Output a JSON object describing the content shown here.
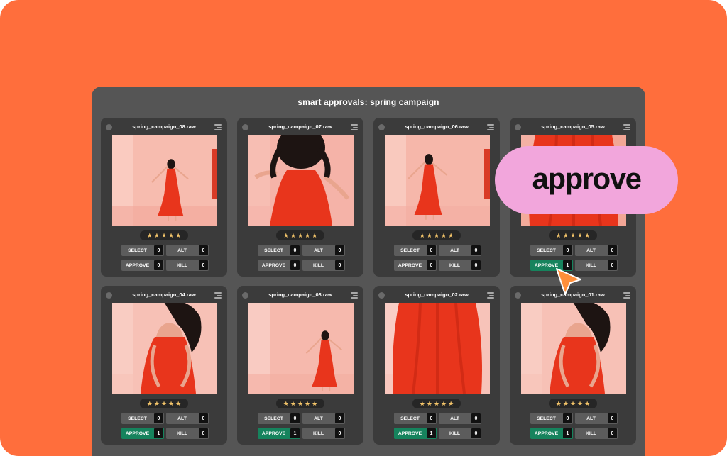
{
  "app": {
    "title": "smart approvals: spring campaign"
  },
  "labels": {
    "select": "SELECT",
    "alt": "ALT",
    "approve": "APPROVE",
    "kill": "KILL"
  },
  "cards": [
    {
      "file": "spring_campaign_08.raw",
      "rating": 5,
      "counts": {
        "select": "0",
        "alt": "0",
        "approve": "0",
        "kill": "0"
      },
      "approved": false
    },
    {
      "file": "spring_campaign_07.raw",
      "rating": 5,
      "counts": {
        "select": "0",
        "alt": "0",
        "approve": "0",
        "kill": "0"
      },
      "approved": false
    },
    {
      "file": "spring_campaign_06.raw",
      "rating": 5,
      "counts": {
        "select": "0",
        "alt": "0",
        "approve": "0",
        "kill": "0"
      },
      "approved": false
    },
    {
      "file": "spring_campaign_05.raw",
      "rating": 5,
      "counts": {
        "select": "0",
        "alt": "0",
        "approve": "1",
        "kill": "0"
      },
      "approved": true
    },
    {
      "file": "spring_campaign_04.raw",
      "rating": 5,
      "counts": {
        "select": "0",
        "alt": "0",
        "approve": "1",
        "kill": "0"
      },
      "approved": true
    },
    {
      "file": "spring_campaign_03.raw",
      "rating": 5,
      "counts": {
        "select": "0",
        "alt": "0",
        "approve": "1",
        "kill": "0"
      },
      "approved": true
    },
    {
      "file": "spring_campaign_02.raw",
      "rating": 5,
      "counts": {
        "select": "0",
        "alt": "0",
        "approve": "1",
        "kill": "0"
      },
      "approved": true
    },
    {
      "file": "spring_campaign_01.raw",
      "rating": 5,
      "counts": {
        "select": "0",
        "alt": "0",
        "approve": "1",
        "kill": "0"
      },
      "approved": true
    }
  ],
  "callout": {
    "text": "approve"
  },
  "icons": {
    "status": "status-dot-icon",
    "menu": "menu-lines-icon",
    "star": "star-icon",
    "cursor": "arrow-cursor-icon"
  },
  "colors": {
    "background": "#ff6e3c",
    "panel": "#555555",
    "card": "#3b3b3b",
    "approve_active": "#16835d",
    "callout": "#f2a6dc",
    "star": "#f4c56a"
  }
}
